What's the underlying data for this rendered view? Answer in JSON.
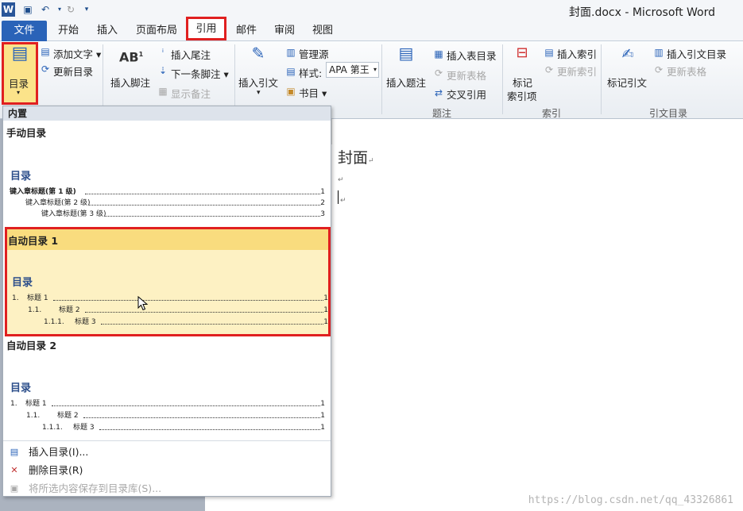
{
  "app": {
    "title": "封面.docx - Microsoft Word",
    "logo": "W"
  },
  "qat": {
    "icons": [
      "save-icon",
      "undo-icon",
      "redo-icon",
      "customize-icon"
    ]
  },
  "tabs": {
    "file": "文件",
    "home": "开始",
    "insert": "插入",
    "layout": "页面布局",
    "references": "引用",
    "mailings": "邮件",
    "review": "审阅",
    "view": "视图"
  },
  "ribbon": {
    "toc": {
      "label": "目录",
      "add_text": "添加文字",
      "update": "更新目录"
    },
    "footnotes": {
      "insert_footnote": "插入脚注",
      "insert_endnote": "插入尾注",
      "next_footnote": "下一条脚注",
      "show_notes": "显示备注"
    },
    "citations": {
      "insert_citation": "插入引文",
      "manage_sources": "管理源",
      "style_label": "样式:",
      "style_value": "APA 第王",
      "bibliography": "书目"
    },
    "captions": {
      "insert_caption": "插入题注",
      "insert_table_of_figures": "插入表目录",
      "update_table": "更新表格",
      "cross_reference": "交叉引用",
      "group": "题注"
    },
    "index": {
      "mark_entry_line1": "标记",
      "mark_entry_line2": "索引项",
      "insert_index": "插入索引",
      "update_index": "更新索引",
      "group": "索引"
    },
    "authorities": {
      "mark_citation": "标记引文",
      "insert_table": "插入引文目录",
      "update_table": "更新表格",
      "group": "引文目录"
    }
  },
  "dropdown": {
    "builtin_header": "内置",
    "galleries": [
      {
        "title": "手动目录",
        "toc_heading": "目录",
        "entries": [
          {
            "text": "键入章标题(第 1 级)",
            "page": "1"
          },
          {
            "text": "键入章标题(第 2 级)",
            "page": "2"
          },
          {
            "text": "键入章标题(第 3 级)",
            "page": "3"
          }
        ]
      },
      {
        "title": "自动目录 1",
        "toc_heading": "目录",
        "entries": [
          {
            "num": "1.",
            "text": "标题 1",
            "page": "1"
          },
          {
            "num": "1.1.",
            "text": "标题 2",
            "page": "1"
          },
          {
            "num": "1.1.1.",
            "text": "标题 3",
            "page": "1"
          }
        ]
      },
      {
        "title": "自动目录 2",
        "toc_heading": "目录",
        "entries": [
          {
            "num": "1.",
            "text": "标题 1",
            "page": "1"
          },
          {
            "num": "1.1.",
            "text": "标题 2",
            "page": "1"
          },
          {
            "num": "1.1.1.",
            "text": "标题 3",
            "page": "1"
          }
        ]
      }
    ],
    "menu": {
      "insert_toc": "插入目录(I)...",
      "remove_toc": "删除目录(R)",
      "save_selection": "将所选内容保存到目录库(S)..."
    }
  },
  "document": {
    "title": "封面",
    "para_mark": "↵"
  },
  "watermark": "https://blog.csdn.net/qq_43326861",
  "colors": {
    "file_tab": "#2a63b8",
    "highlight_box": "#e02020",
    "selected_gallery": "#f9dc7e",
    "toc_heading": "#2d4f8b"
  }
}
